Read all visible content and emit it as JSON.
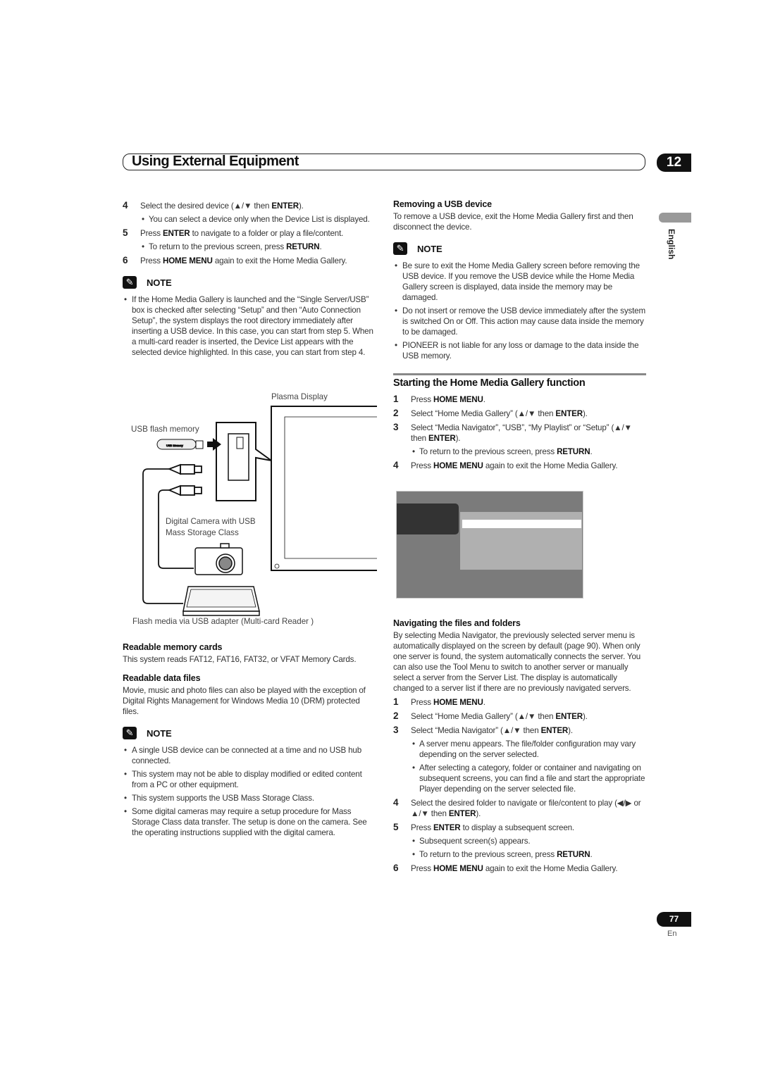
{
  "header": {
    "title": "Using External Equipment",
    "chapter": "12",
    "language": "English"
  },
  "left_a": [
    {
      "type": "step",
      "num": "4",
      "segs": [
        "Select the desired device (▲/▼ then ",
        "ENTER",
        ")."
      ]
    },
    {
      "type": "bullet",
      "segs": [
        "You can select a device only when the Device List is displayed."
      ]
    },
    {
      "type": "step",
      "num": "5",
      "segs": [
        "Press ",
        "ENTER",
        " to navigate to a folder or play a file/content."
      ]
    },
    {
      "type": "bullet",
      "segs": [
        "To return to the previous screen, press ",
        "RETURN",
        "."
      ]
    },
    {
      "type": "step",
      "num": "6",
      "segs": [
        "Press ",
        "HOME MENU",
        " again to exit the Home Media Gallery."
      ]
    },
    {
      "type": "note",
      "label": "NOTE"
    },
    {
      "type": "nbullet",
      "segs": [
        "If the Home Media Gallery is launched and the “Single Server/USB” box is checked after selecting “Setup” and then “Auto Connection Setup”, the system displays the root directory immediately after inserting a USB device. In this case, you can start from step 5. When a multi-card reader is inserted, the Device List appears with the selected device highlighted. In this case, you can start from step 4."
      ]
    }
  ],
  "diagram": {
    "plasma_display": "Plasma Display",
    "usb_flash_memory": "USB flash memory",
    "usb_memory_stick_label": "USB Memory",
    "digital_camera_line1": "Digital Camera with USB",
    "digital_camera_line2": "Mass Storage Class",
    "card_reader": "Flash media via USB adapter (Multi-card Reader )"
  },
  "left_b": [
    {
      "type": "h",
      "segs": [
        "Readable memory cards"
      ]
    },
    {
      "type": "p",
      "segs": [
        "This system reads FAT12, FAT16, FAT32, or VFAT Memory Cards."
      ]
    },
    {
      "type": "h",
      "segs": [
        "Readable data files"
      ]
    },
    {
      "type": "p",
      "segs": [
        "Movie, music and photo files can also be played with the exception of Digital Rights Management for Windows Media 10 (DRM) protected files."
      ]
    },
    {
      "type": "note",
      "label": "NOTE"
    },
    {
      "type": "nbullet",
      "segs": [
        "A single USB device can be connected at a time and no USB hub connected."
      ]
    },
    {
      "type": "nbullet",
      "segs": [
        "This system may not be able to display modified or edited content from a PC or other equipment."
      ]
    },
    {
      "type": "nbullet",
      "segs": [
        "This system supports the USB Mass Storage Class."
      ]
    },
    {
      "type": "nbullet",
      "segs": [
        "Some digital cameras may require a setup procedure for Mass Storage Class data transfer. The setup is done on the camera. See the operating instructions supplied with the digital camera."
      ]
    }
  ],
  "right_a": [
    {
      "type": "h",
      "segs": [
        "Removing a USB device"
      ]
    },
    {
      "type": "p",
      "segs": [
        "To remove a USB device, exit the Home Media Gallery first and then disconnect the device."
      ]
    },
    {
      "type": "note",
      "label": "NOTE"
    },
    {
      "type": "nbullet",
      "segs": [
        "Be sure to exit the Home Media Gallery screen before removing the USB device. If you remove the USB device while the Home Media Gallery screen is displayed, data inside the memory may be damaged."
      ]
    },
    {
      "type": "nbullet",
      "segs": [
        "Do not insert or remove the USB device immediately after the system is switched On or Off. This action may cause data inside the memory to be damaged."
      ]
    },
    {
      "type": "nbullet",
      "segs": [
        "PIONEER is not liable for any loss or damage to the data inside the USB memory."
      ]
    }
  ],
  "section_title": "Starting the Home Media Gallery function",
  "right_b": [
    {
      "type": "step",
      "num": "1",
      "segs": [
        "Press ",
        "HOME MENU",
        "."
      ]
    },
    {
      "type": "step",
      "num": "2",
      "segs": [
        "Select “Home Media Gallery” (▲/▼ then ",
        "ENTER",
        ")."
      ]
    },
    {
      "type": "step",
      "num": "3",
      "segs": [
        "Select “Media Navigator”, “USB”, “My Playlist” or “Setup” (▲/▼ then ",
        "ENTER",
        ")."
      ]
    },
    {
      "type": "bullet",
      "segs": [
        "To return to the previous screen, press ",
        "RETURN",
        "."
      ]
    },
    {
      "type": "step",
      "num": "4",
      "segs": [
        "Press ",
        "HOME MENU",
        " again to exit the Home Media Gallery."
      ]
    }
  ],
  "right_c": [
    {
      "type": "h",
      "segs": [
        "Navigating the files and folders"
      ]
    },
    {
      "type": "p",
      "segs": [
        "By selecting Media Navigator, the previously selected server menu is automatically displayed on the screen by default (page 90). When only one server is found, the system automatically connects the server. You can also use the Tool Menu to switch to another server or manually select a server from the Server List. The display is automatically changed to a server list if there are no previously navigated servers."
      ]
    },
    {
      "type": "step",
      "num": "1",
      "segs": [
        "Press ",
        "HOME MENU",
        "."
      ]
    },
    {
      "type": "step",
      "num": "2",
      "segs": [
        "Select “Home Media Gallery” (▲/▼ then ",
        "ENTER",
        ")."
      ]
    },
    {
      "type": "step",
      "num": "3",
      "segs": [
        "Select “Media Navigator” (▲/▼ then ",
        "ENTER",
        ")."
      ]
    },
    {
      "type": "bullet",
      "segs": [
        "A server menu appears. The file/folder configuration may vary depending on the server selected."
      ]
    },
    {
      "type": "bullet",
      "segs": [
        "After selecting a category, folder or container and navigating on subsequent screens, you can find a file and start the appropriate Player depending on the server selected file."
      ]
    },
    {
      "type": "step",
      "num": "4",
      "segs": [
        "Select the desired folder to navigate or file/content to play (◀/▶ or ▲/▼ then ",
        "ENTER",
        ")."
      ]
    },
    {
      "type": "step",
      "num": "5",
      "segs": [
        "Press ",
        "ENTER",
        " to display a subsequent screen."
      ]
    },
    {
      "type": "bullet",
      "segs": [
        "Subsequent screen(s) appears."
      ]
    },
    {
      "type": "bullet",
      "segs": [
        "To return to the previous screen, press ",
        "RETURN",
        "."
      ]
    },
    {
      "type": "step",
      "num": "6",
      "segs": [
        "Press ",
        "HOME MENU",
        " again to exit the Home Media Gallery."
      ]
    }
  ],
  "footer": {
    "page_number": "77",
    "lang_code": "En"
  }
}
